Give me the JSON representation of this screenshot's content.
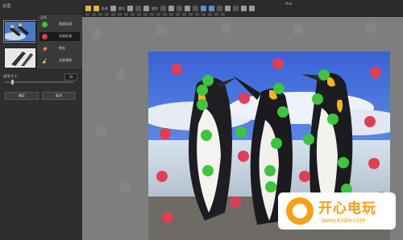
{
  "sidebar": {
    "title": "处理",
    "popup_label": "画笔",
    "brushes": [
      {
        "label": "保留区域",
        "icon": "green-dot-icon",
        "active": false
      },
      {
        "label": "去除区域",
        "icon": "red-dot-icon",
        "active": true
      },
      {
        "label": "擦去",
        "icon": "eraser-icon",
        "active": false
      },
      {
        "label": "全部清除",
        "icon": "broom-icon",
        "active": false
      }
    ],
    "size_label": "画笔大小",
    "size_value": "16",
    "confirm_label": "确定",
    "cancel_label": "取消"
  },
  "topbar": {
    "window_title": "Mob",
    "labels": [
      "处理",
      "裁切",
      "旋转"
    ]
  },
  "watermark": {
    "title": "开心电玩",
    "url": "www.kxdw.com"
  },
  "colors": {
    "keep_marker": "#3ec43e",
    "remove_marker": "#e03e55"
  }
}
